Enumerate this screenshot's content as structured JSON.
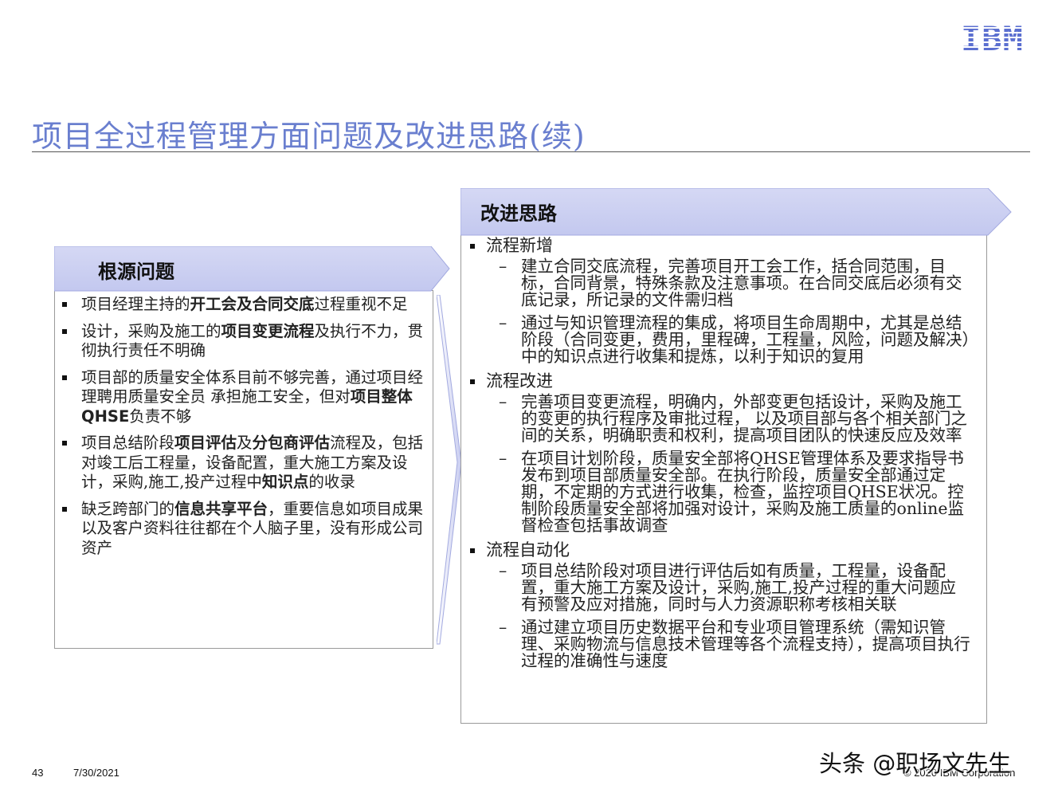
{
  "logo": {
    "text": "IBM",
    "color": "#5b6fd0"
  },
  "title": "项目全过程管理方面问题及改进思路(续)",
  "colors": {
    "title": "#6a7fcf",
    "header_fill": "#c9cdf0",
    "header_edge": "#a3aae0"
  },
  "left_panel": {
    "header": "根源问题",
    "items": [
      [
        {
          "t": "项目经理主持的"
        },
        {
          "t": "开工会及合同交底",
          "b": true
        },
        {
          "t": "过程重视不足"
        }
      ],
      [
        {
          "t": "设计，采购及施工的"
        },
        {
          "t": "项目变更流程",
          "b": true
        },
        {
          "t": "及执行不力，贯彻执行责任不明确"
        }
      ],
      [
        {
          "t": "项目部的质量安全体系目前不够完善，通过项目经理聘用质量安全员 承担施工安全，但对"
        },
        {
          "t": "项目整体QHSE",
          "b": true
        },
        {
          "t": "负责不够"
        }
      ],
      [
        {
          "t": "项目总结阶段"
        },
        {
          "t": "项目评估",
          "b": true
        },
        {
          "t": "及"
        },
        {
          "t": "分包商评估",
          "b": true
        },
        {
          "t": "流程及，包括对竣工后工程量，设备配置，重大施工方案及设计，采购,施工,投产过程中"
        },
        {
          "t": "知识点",
          "b": true
        },
        {
          "t": "的收录"
        }
      ],
      [
        {
          "t": "缺乏跨部门的"
        },
        {
          "t": "信息共享平台",
          "b": true
        },
        {
          "t": "，重要信息如项目成果以及客户资料往往都在个人脑子里，没有形成公司资产"
        }
      ]
    ]
  },
  "right_panel": {
    "header": "改进思路",
    "sections": [
      {
        "title": "流程新增",
        "items": [
          "建立合同交底流程，完善项目开工会工作，括合同范围，目标，合同背景，特殊条款及注意事项。在合同交底后必须有交底记录，所记录的文件需归档",
          "通过与知识管理流程的集成，将项目生命周期中，尤其是总结阶段（合同变更，费用，里程碑，工程量，风险，问题及解决）中的知识点进行收集和提炼，以利于知识的复用"
        ]
      },
      {
        "title": "流程改进",
        "items": [
          "完善项目变更流程，明确内，外部变更包括设计，采购及施工的变更的执行程序及审批过程， 以及项目部与各个相关部门之间的关系，明确职责和权利，提高项目团队的快速反应及效率",
          "在项目计划阶段，质量安全部将QHSE管理体系及要求指导书发布到项目部质量安全部。在执行阶段，质量安全部通过定期，不定期的方式进行收集，检查，监控项目QHSE状况。控制阶段质量安全部将加强对设计，采购及施工质量的online监督检查包括事故调查"
        ]
      },
      {
        "title": "流程自动化",
        "items": [
          "项目总结阶段对项目进行评估后如有质量，工程量，设备配置，重大施工方案及设计，采购,施工,投产过程的重大问题应有预警及应对措施，同时与人力资源职称考核相关联",
          "通过建立项目历史数据平台和专业项目管理系统（需知识管理、采购物流与信息技术管理等各个流程支持），提高项目执行过程的准确性与速度"
        ]
      }
    ]
  },
  "footer": {
    "page": "43",
    "date": "7/30/2021",
    "copyright": "© 2020 IBM Corporation"
  },
  "watermark": "头条 @职场文先生"
}
